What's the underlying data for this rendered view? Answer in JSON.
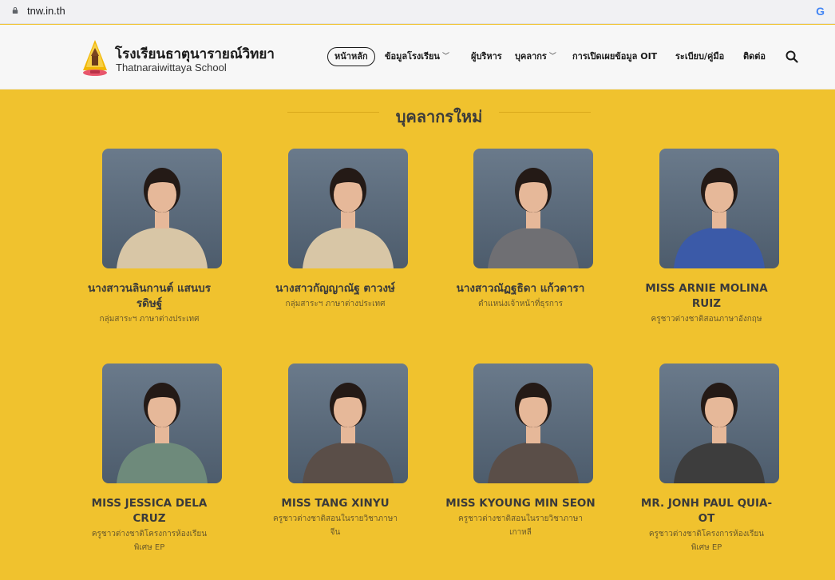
{
  "browser": {
    "url": "tnw.in.th",
    "google_icon": "G"
  },
  "header": {
    "school_name_th": "โรงเรียนธาตุนารายณ์วิทยา",
    "school_name_en": "Thatnaraiwittaya School"
  },
  "nav": {
    "items": [
      {
        "label": "หน้าหลัก",
        "dropdown": false,
        "active": true
      },
      {
        "label": "ข้อมูลโรงเรียน",
        "dropdown": true,
        "active": false
      },
      {
        "label": "ผู้บริหาร",
        "dropdown": false,
        "active": false
      },
      {
        "label": "บุคลากร",
        "dropdown": true,
        "active": false
      },
      {
        "label": "การเปิดเผยข้อมูล OIT",
        "dropdown": false,
        "active": false
      },
      {
        "label": "ระเบียบ/คู่มือ",
        "dropdown": false,
        "active": false
      },
      {
        "label": "ติดต่อ",
        "dropdown": false,
        "active": false
      }
    ],
    "dropdown_glyph": "﹀"
  },
  "section": {
    "title": "บุคลากรใหม่"
  },
  "people": [
    {
      "name_line1": "นางสาวนลินกานต์ แสนบร",
      "name_line2": "รดิษฐ์",
      "role_line1": "กลุ่มสาระฯ ภาษาต่างประเทศ",
      "role_line2": ""
    },
    {
      "name_line1": "นางสาวกัญญาณัฐ ตาวงษ์",
      "name_line2": "",
      "role_line1": "กลุ่มสาระฯ ภาษาต่างประเทศ",
      "role_line2": ""
    },
    {
      "name_line1": "นางสาวณัฏฐธิดา แก้วดารา",
      "name_line2": "",
      "role_line1": "ตำแหน่งเจ้าหน้าที่ธุรการ",
      "role_line2": ""
    },
    {
      "name_line1": "MISS ARNIE MOLINA",
      "name_line2": "RUIZ",
      "role_line1": "ครูชาวต่างชาติสอนภาษาอังกฤษ",
      "role_line2": ""
    },
    {
      "name_line1": "MISS JESSICA DELA",
      "name_line2": "CRUZ",
      "role_line1": "ครูชาวต่างชาติโครงการห้องเรียน",
      "role_line2": "พิเศษ EP"
    },
    {
      "name_line1": "MISS TANG XINYU",
      "name_line2": "",
      "role_line1": "ครูชาวต่างชาติสอนในรายวิชาภาษา",
      "role_line2": "จีน"
    },
    {
      "name_line1": "MISS KYOUNG MIN SEON",
      "name_line2": "",
      "role_line1": "ครูชาวต่างชาติสอนในรายวิชาภาษา",
      "role_line2": "เกาหลี"
    },
    {
      "name_line1": "MR. JONH PAUL QUIA-",
      "name_line2": "OT",
      "role_line1": "ครูชาวต่างชาติโครงการห้องเรียน",
      "role_line2": "พิเศษ EP"
    }
  ],
  "colors": {
    "page_bg": "#f0c22e",
    "header_bg": "#f7f7f7",
    "photo_bg": "#5d6d7f",
    "name_text": "#3a3a3a",
    "role_text": "#6b5a2a"
  }
}
